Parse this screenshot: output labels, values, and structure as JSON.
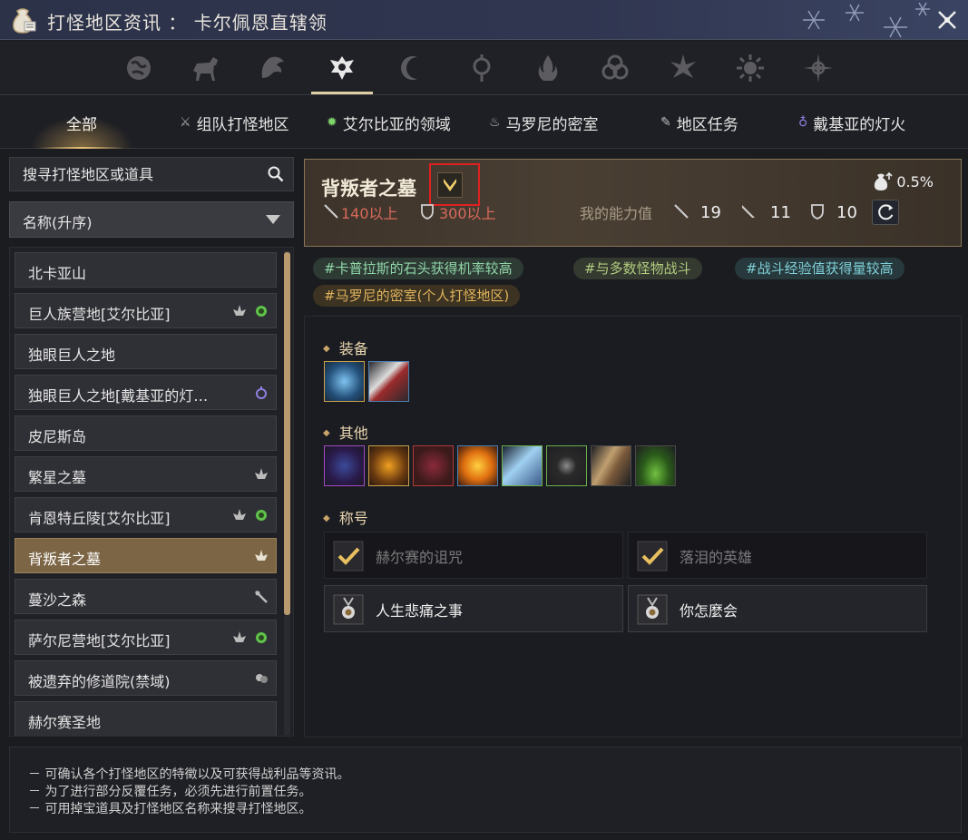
{
  "window": {
    "title": "打怪地区资讯 ： 卡尔佩恩直辖领"
  },
  "category_icons": [
    "globe-icon",
    "horse-icon",
    "beast-icon",
    "crest-icon",
    "moon-icon",
    "orb-icon",
    "flame-icon",
    "knot-icon",
    "star-icon",
    "sun-icon",
    "compass-icon"
  ],
  "tabs": [
    {
      "label": "全部",
      "icon": ""
    },
    {
      "label": "组队打怪地区",
      "icon": "party-icon"
    },
    {
      "label": "艾尔比亚的领域",
      "icon": "elvia-icon"
    },
    {
      "label": "马罗尼的密室",
      "icon": "marni-icon"
    },
    {
      "label": "地区任务",
      "icon": "quest-icon"
    },
    {
      "label": "戴基亚的灯火",
      "icon": "lantern-icon"
    }
  ],
  "search": {
    "placeholder": "搜寻打怪地区或道具"
  },
  "sort": {
    "label": "名称(升序)"
  },
  "list": [
    {
      "label": "北卡亚山"
    },
    {
      "label": "巨人族营地[艾尔比亚]"
    },
    {
      "label": "独眼巨人之地"
    },
    {
      "label": "独眼巨人之地[戴基亚的灯…"
    },
    {
      "label": "皮尼斯岛"
    },
    {
      "label": "繁星之墓"
    },
    {
      "label": "肯恩特丘陵[艾尔比亚]"
    },
    {
      "label": "背叛者之墓"
    },
    {
      "label": "蔓沙之森"
    },
    {
      "label": "萨尔尼营地[艾尔比亚]"
    },
    {
      "label": "被遗弃的修道院(禁域)"
    },
    {
      "label": "赫尔赛圣地"
    }
  ],
  "detail": {
    "name": "背叛者之墓",
    "req_ap": "140以上",
    "req_dp": "300以上",
    "my_stats_label": "我的能力值",
    "my_ap": "19",
    "my_aap": "11",
    "my_dp": "10",
    "drop_rate": "0.5%",
    "tags": [
      "#卡普拉斯的石头获得机率较高",
      "#与多数怪物战斗",
      "#战斗经验值获得量较高",
      "#马罗尼的密室(个人打怪地区)"
    ],
    "sections": {
      "equipment": "装备",
      "other": "其他",
      "titles": "称号"
    },
    "titles": [
      {
        "name": "赫尔赛的诅咒",
        "completed": true
      },
      {
        "name": "落泪的英雄",
        "completed": true
      },
      {
        "name": "人生悲痛之事",
        "completed": false
      },
      {
        "name": "你怎麼会",
        "completed": false
      }
    ]
  },
  "info": [
    "－ 可确认各个打怪地区的特徵以及可获得战利品等资讯。",
    "－ 为了进行部分反覆任务，必须先进行前置任务。",
    "－ 可用掉宝道具及打怪地区名称来搜寻打怪地区。"
  ]
}
